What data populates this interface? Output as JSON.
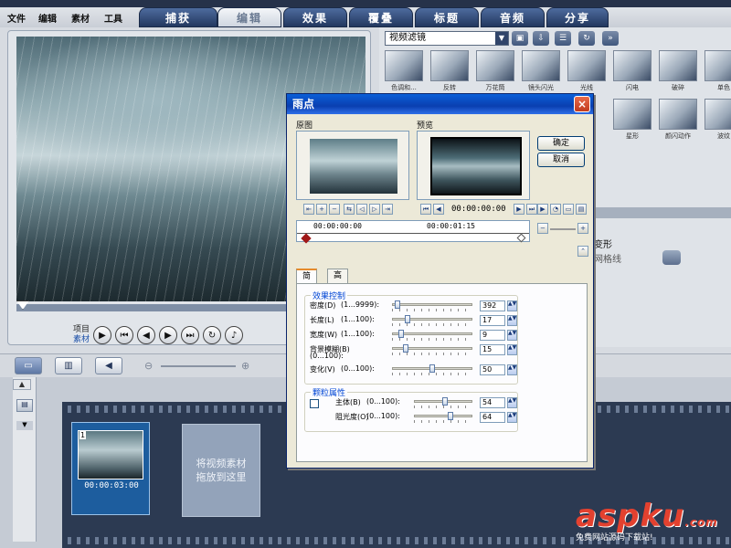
{
  "menu": [
    "文件",
    "编辑",
    "素材",
    "工具"
  ],
  "tabs": [
    {
      "label": "捕获",
      "active": false
    },
    {
      "label": "编辑",
      "active": true
    },
    {
      "label": "效果",
      "active": false
    },
    {
      "label": "覆叠",
      "active": false
    },
    {
      "label": "标题",
      "active": false
    },
    {
      "label": "音频",
      "active": false
    },
    {
      "label": "分享",
      "active": false
    }
  ],
  "preview": {
    "mode_project": "项目",
    "mode_clip": "素材",
    "controls": [
      "play-icon",
      "go-start-icon",
      "prev-frame-icon",
      "next-frame-icon",
      "go-end-icon",
      "repeat-icon",
      "volume-icon"
    ]
  },
  "library": {
    "dropdown": "视频滤镜",
    "row1_labels": [
      "色调和...",
      "反转",
      "万花筒",
      "镜头闪光",
      "光线",
      "闪电",
      "破碎",
      "单色"
    ],
    "row2_labels": [
      "星形",
      "颜闪动作",
      "波纹"
    ],
    "side_labels": [
      "变形",
      "网格线"
    ]
  },
  "dialog": {
    "title": "雨点",
    "close": "×",
    "original_label": "原图",
    "preview_label": "预览",
    "ok": "确定",
    "cancel": "取消",
    "time_left": "00:00:00:00",
    "time_current": "00:00:00:00",
    "time_end": "00:00:01:15",
    "tabs": [
      {
        "label": "简单",
        "active": true
      },
      {
        "label": "高级",
        "active": false
      }
    ],
    "effect_group_title": "效果控制",
    "params": [
      {
        "label": "密度(D)",
        "range": "(1...9999):",
        "value": "392",
        "fraction": 0.04
      },
      {
        "label": "长度(L)",
        "range": "(1...100):",
        "value": "17",
        "fraction": 0.17
      },
      {
        "label": "宽度(W)",
        "range": "(1...100):",
        "value": "9",
        "fraction": 0.09
      },
      {
        "label": "背景模糊(B)",
        "range": "(0...100):",
        "value": "15",
        "fraction": 0.15
      },
      {
        "label": "变化(V)",
        "range": "(0...100):",
        "value": "50",
        "fraction": 0.5
      }
    ],
    "particle_group_title": "颗粒属性",
    "particle_params": [
      {
        "label": "主体(B)",
        "range": "(0...100):",
        "value": "54",
        "fraction": 0.54
      },
      {
        "label": "阻光度(O)",
        "range": "(0...100):",
        "value": "64",
        "fraction": 0.64
      }
    ]
  },
  "timeline": {
    "clip_time": "00:00:03:00",
    "clip_index": "1",
    "drop_hint_line1": "将视频素材",
    "drop_hint_line2": "拖放到这里"
  },
  "watermark": {
    "main": "aspku",
    "suffix": ".com",
    "sub": "免费网站源码下载站!"
  }
}
